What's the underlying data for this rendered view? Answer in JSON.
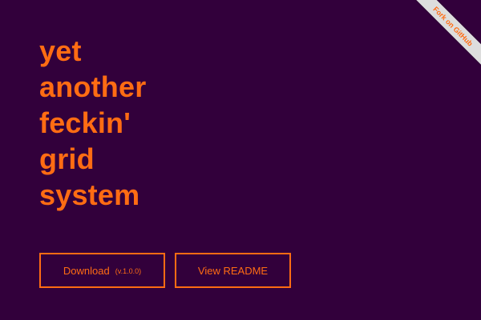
{
  "title": {
    "lines": [
      "yet",
      "another",
      "feckin'",
      "grid",
      "system"
    ]
  },
  "buttons": {
    "download_label": "Download",
    "download_version": "(v.1.0.0)",
    "readme_label": "View README"
  },
  "ribbon": {
    "label": "Fork on GitHub"
  },
  "colors": {
    "background": "#32003b",
    "accent": "#ff6c13",
    "ribbon_background": "#dddddd"
  }
}
